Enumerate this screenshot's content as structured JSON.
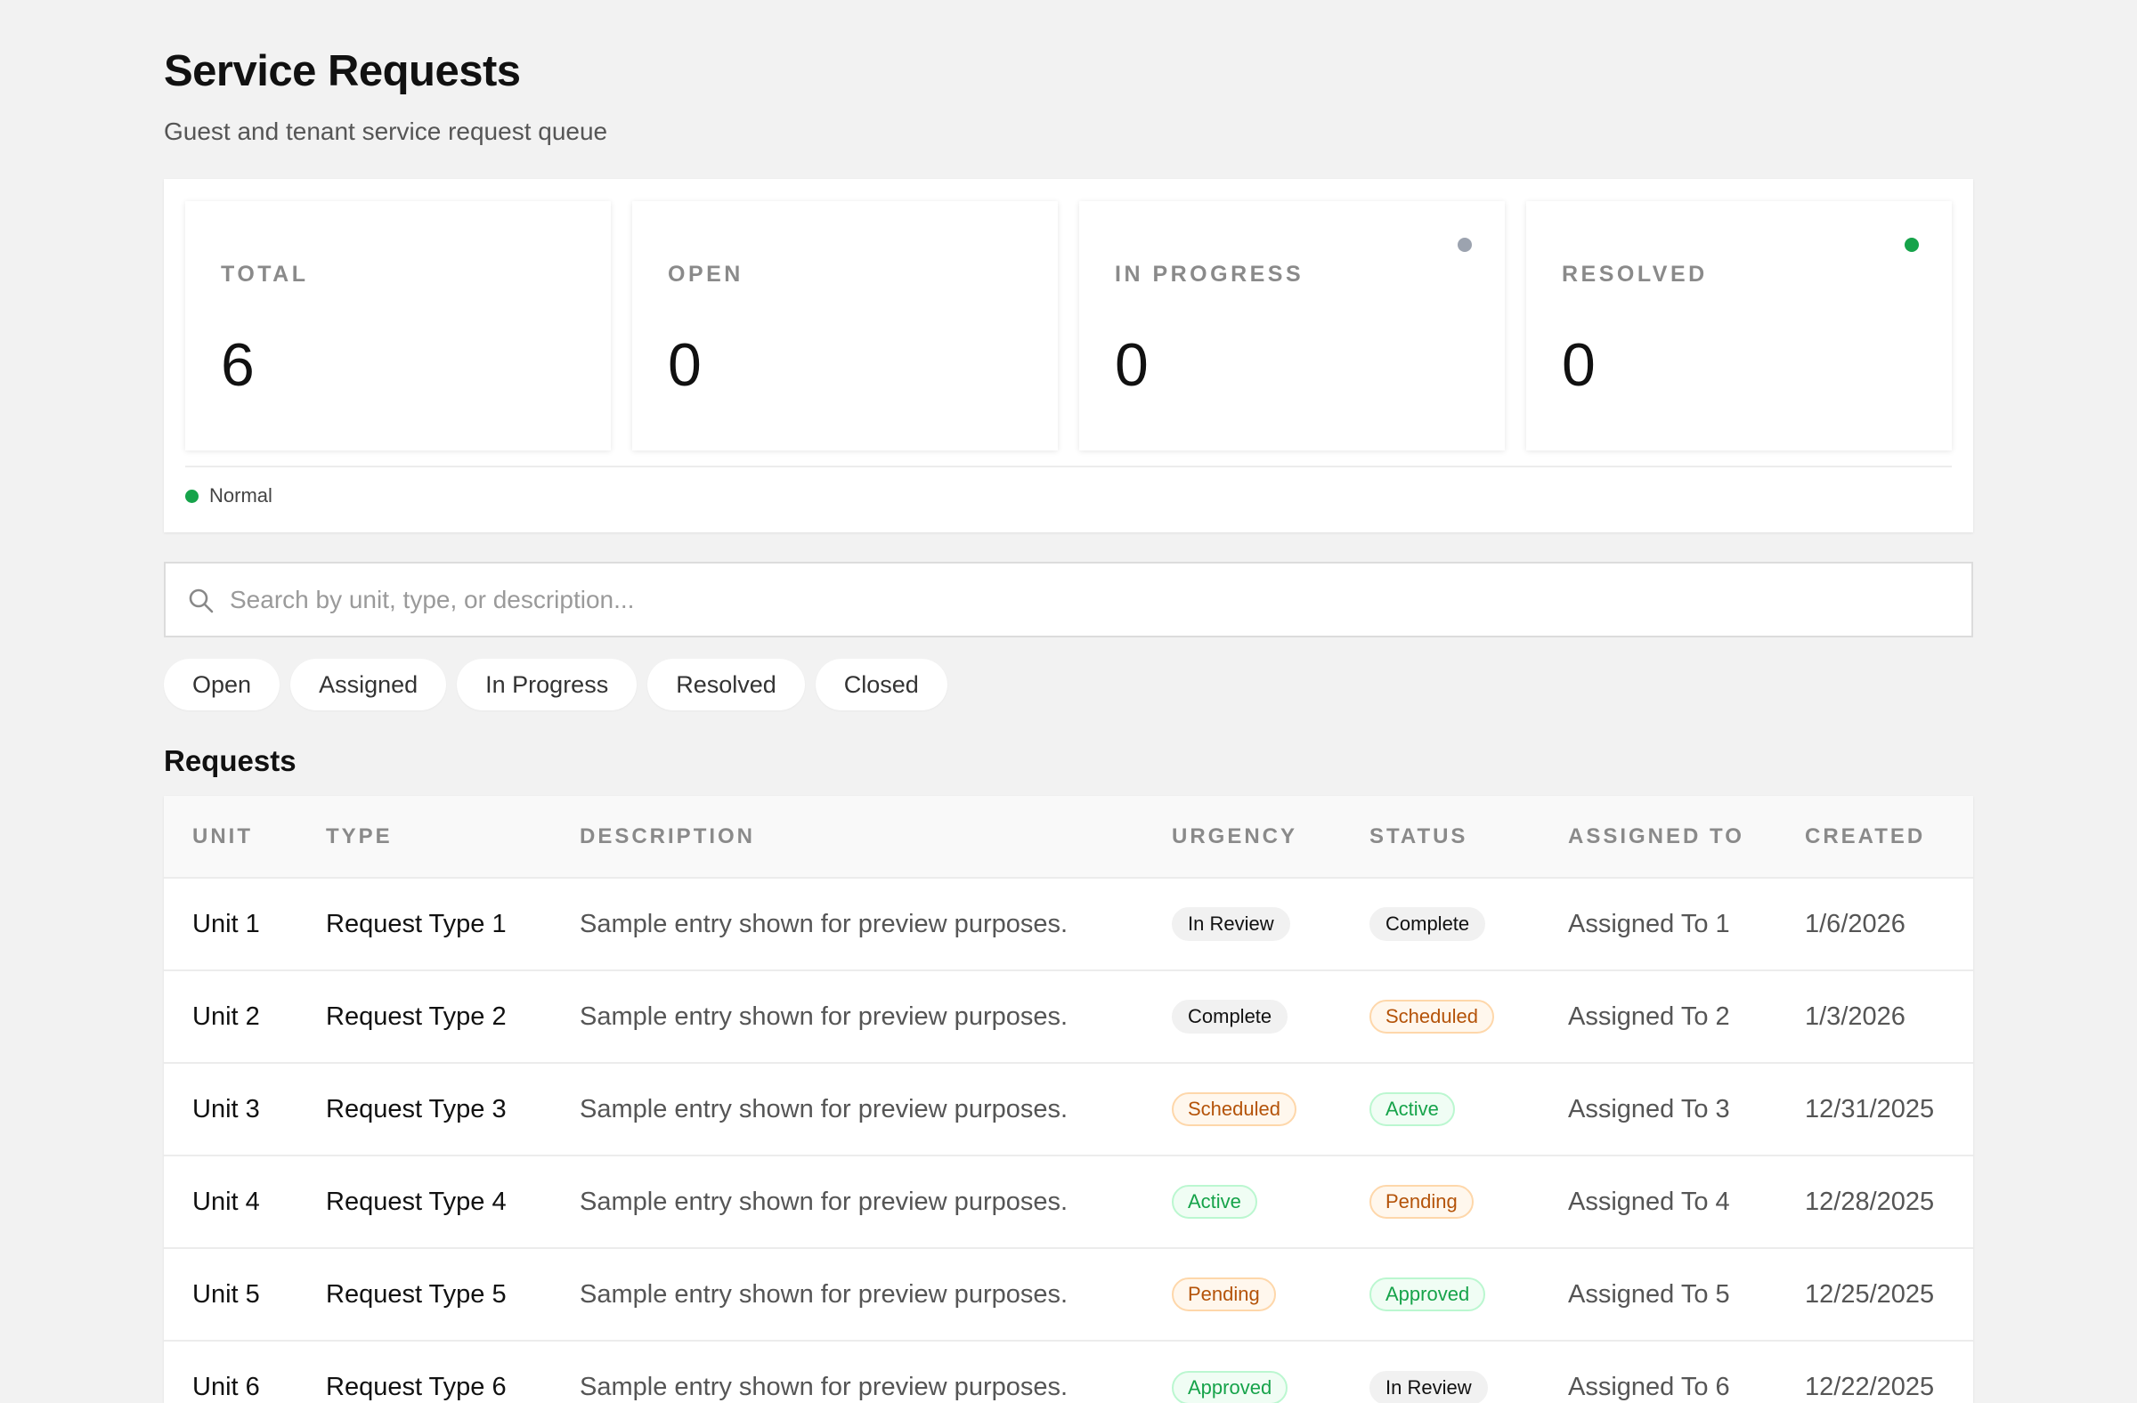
{
  "header": {
    "title": "Service Requests",
    "subtitle": "Guest and tenant service request queue"
  },
  "stats": [
    {
      "label": "TOTAL",
      "value": "6"
    },
    {
      "label": "OPEN",
      "value": "0"
    },
    {
      "label": "IN PROGRESS",
      "value": "0",
      "dot_color": "#9ca3af"
    },
    {
      "label": "RESOLVED",
      "value": "0",
      "dot_color": "#16a34a"
    }
  ],
  "legend": {
    "label": "Normal",
    "color": "#16a34a"
  },
  "search": {
    "placeholder": "Search by unit, type, or description..."
  },
  "filters": [
    "Open",
    "Assigned",
    "In Progress",
    "Resolved",
    "Closed"
  ],
  "section_title": "Requests",
  "table": {
    "columns": [
      "UNIT",
      "TYPE",
      "DESCRIPTION",
      "URGENCY",
      "STATUS",
      "ASSIGNED TO",
      "CREATED"
    ],
    "rows": [
      {
        "unit": "Unit 1",
        "type": "Request Type 1",
        "description": "Sample entry shown for preview purposes.",
        "urgency": "In Review",
        "status": "Complete",
        "assigned_to": "Assigned To 1",
        "created": "1/6/2026"
      },
      {
        "unit": "Unit 2",
        "type": "Request Type 2",
        "description": "Sample entry shown for preview purposes.",
        "urgency": "Complete",
        "status": "Scheduled",
        "assigned_to": "Assigned To 2",
        "created": "1/3/2026"
      },
      {
        "unit": "Unit 3",
        "type": "Request Type 3",
        "description": "Sample entry shown for preview purposes.",
        "urgency": "Scheduled",
        "status": "Active",
        "assigned_to": "Assigned To 3",
        "created": "12/31/2025"
      },
      {
        "unit": "Unit 4",
        "type": "Request Type 4",
        "description": "Sample entry shown for preview purposes.",
        "urgency": "Active",
        "status": "Pending",
        "assigned_to": "Assigned To 4",
        "created": "12/28/2025"
      },
      {
        "unit": "Unit 5",
        "type": "Request Type 5",
        "description": "Sample entry shown for preview purposes.",
        "urgency": "Pending",
        "status": "Approved",
        "assigned_to": "Assigned To 5",
        "created": "12/25/2025"
      },
      {
        "unit": "Unit 6",
        "type": "Request Type 6",
        "description": "Sample entry shown for preview purposes.",
        "urgency": "Approved",
        "status": "In Review",
        "assigned_to": "Assigned To 6",
        "created": "12/22/2025"
      }
    ]
  },
  "badge_styles": {
    "In Review": {
      "bg": "#f1f1f1",
      "fg": "#111111",
      "border": "#f1f1f1"
    },
    "Complete": {
      "bg": "#f1f1f1",
      "fg": "#111111",
      "border": "#f1f1f1"
    },
    "Scheduled": {
      "bg": "#fff7ed",
      "fg": "#b45309",
      "border": "#fed7aa"
    },
    "Pending": {
      "bg": "#fff7ed",
      "fg": "#b45309",
      "border": "#fed7aa"
    },
    "Active": {
      "bg": "#f0fdf4",
      "fg": "#16a34a",
      "border": "#bbf7d0"
    },
    "Approved": {
      "bg": "#f0fdf4",
      "fg": "#16a34a",
      "border": "#bbf7d0"
    }
  }
}
